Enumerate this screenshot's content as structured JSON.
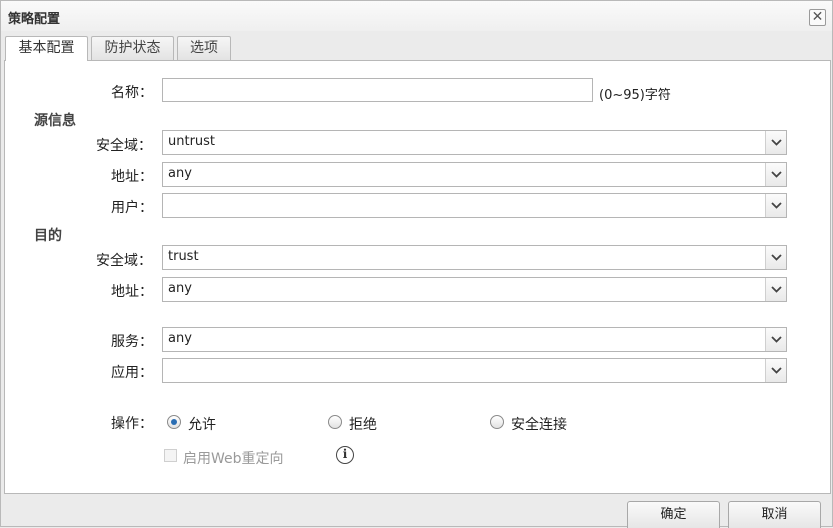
{
  "dialog": {
    "title": "策略配置",
    "close_glyph": "✕"
  },
  "tabs": [
    {
      "label": "基本配置",
      "active": true
    },
    {
      "label": "防护状态",
      "active": false
    },
    {
      "label": "选项",
      "active": false
    }
  ],
  "form": {
    "name": {
      "label": "名称：",
      "value": "",
      "hint": "(0~95)字符"
    },
    "source": {
      "heading": "源信息",
      "zone": {
        "label": "安全域：",
        "value": "untrust"
      },
      "address": {
        "label": "地址：",
        "value": "any"
      },
      "user": {
        "label": "用户：",
        "value": ""
      }
    },
    "destination": {
      "heading": "目的",
      "zone": {
        "label": "安全域：",
        "value": "trust"
      },
      "address": {
        "label": "地址：",
        "value": "any"
      }
    },
    "service": {
      "label": "服务：",
      "value": "any"
    },
    "application": {
      "label": "应用：",
      "value": ""
    },
    "action": {
      "label": "操作：",
      "options": [
        {
          "label": "允许",
          "checked": true
        },
        {
          "label": "拒绝",
          "checked": false
        },
        {
          "label": "安全连接",
          "checked": false
        }
      ]
    },
    "web_redirect": {
      "label": "启用Web重定向",
      "checked": false,
      "enabled": false
    }
  },
  "buttons": {
    "ok": "确定",
    "cancel": "取消"
  },
  "icons": {
    "dropdown": "chevron-down-icon",
    "info": "info-icon",
    "close": "close-icon"
  },
  "colors": {
    "radio_selected": "#2a6db3",
    "disabled_text": "#9a9a9a"
  }
}
